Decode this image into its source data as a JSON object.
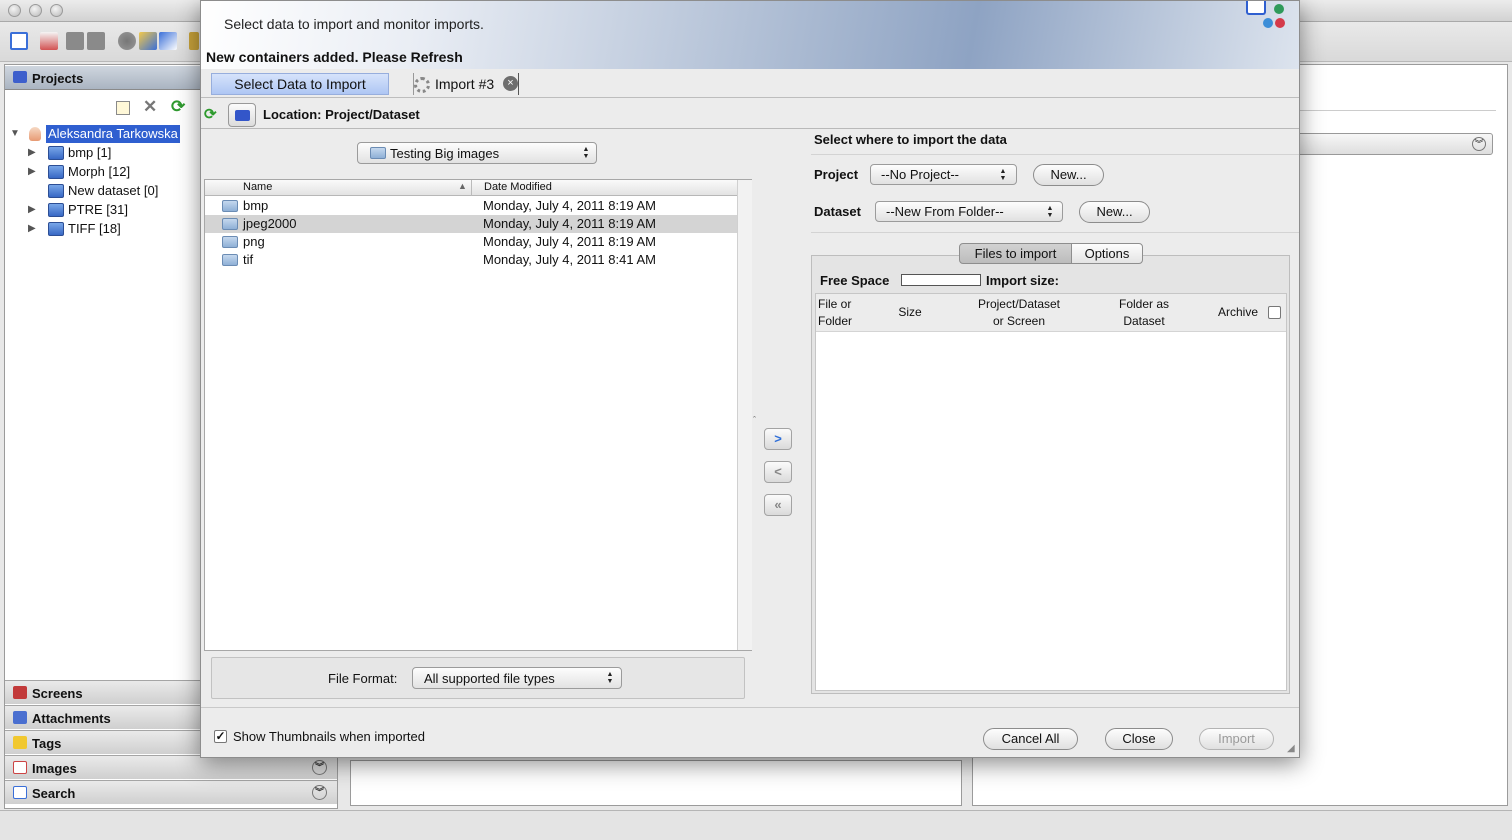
{
  "main_window": {
    "projects_panel": {
      "title": "Projects",
      "tree": {
        "root": "Aleksandra Tarkowska",
        "items": [
          {
            "label": "bmp [1]",
            "expandable": true
          },
          {
            "label": "Morph [12]",
            "expandable": true
          },
          {
            "label": "New dataset [0]",
            "expandable": false
          },
          {
            "label": "PTRE [31]",
            "expandable": true
          },
          {
            "label": "TIFF [18]",
            "expandable": true
          }
        ]
      }
    },
    "side_sections": [
      "Screens",
      "Attachments",
      "Tags",
      "Images",
      "Search"
    ]
  },
  "dialog": {
    "banner_text": "Select data to import and monitor imports.",
    "refresh_message": "New containers added. Please Refresh",
    "tabs": {
      "select": "Select Data to Import",
      "import": "Import #3"
    },
    "location_label": "Location: Project/Dataset",
    "chooser": {
      "current_folder": "Testing Big images",
      "columns": {
        "name": "Name",
        "date": "Date Modified"
      },
      "files": [
        {
          "name": "bmp",
          "date": "Monday, July 4, 2011 8:19 AM"
        },
        {
          "name": "jpeg2000",
          "date": "Monday, July 4, 2011 8:19 AM",
          "selected": true
        },
        {
          "name": "png",
          "date": "Monday, July 4, 2011 8:19 AM"
        },
        {
          "name": "tif",
          "date": "Monday, July 4, 2011 8:41 AM"
        }
      ],
      "format_label": "File Format:",
      "format_value": "All supported file types"
    },
    "destination": {
      "title": "Select where to import the data",
      "project_label": "Project",
      "project_value": "--No Project--",
      "dataset_label": "Dataset",
      "dataset_value": "--New From Folder--",
      "new_button": "New..."
    },
    "queue": {
      "tab_files": "Files to import",
      "tab_options": "Options",
      "free_space_label": "Free Space",
      "import_size_label": "Import size:",
      "headers": {
        "file_or_folder": "File or\nFolder",
        "size": "Size",
        "project_dataset": "Project/Dataset\nor Screen",
        "folder_as_dataset": "Folder as\nDataset",
        "archive": "Archive"
      }
    },
    "footer": {
      "show_thumbnails": "Show Thumbnails when imported",
      "cancel_all": "Cancel All",
      "close": "Close",
      "import": "Import"
    },
    "colors": {
      "tab_active": "#aec6f3",
      "selection": "#2f5fd0"
    }
  }
}
